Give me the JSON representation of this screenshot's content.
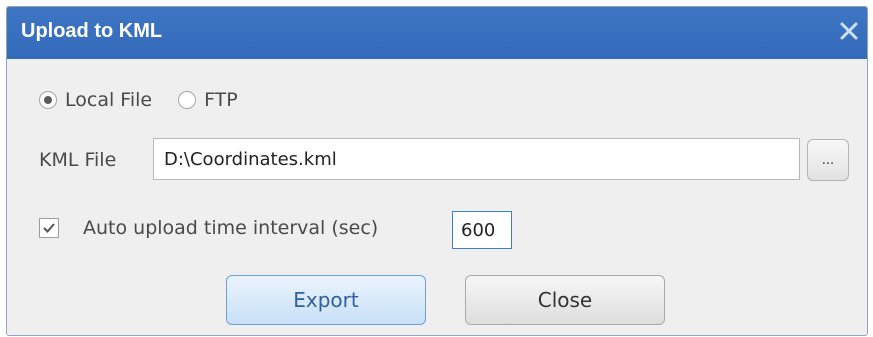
{
  "dialog": {
    "title": "Upload to KML",
    "close_icon": "close-x-icon"
  },
  "source": {
    "options": [
      {
        "label": "Local File",
        "selected": true
      },
      {
        "label": "FTP",
        "selected": false
      }
    ]
  },
  "kml_file": {
    "label": "KML File",
    "value": "D:\\Coordinates.kml",
    "browse_label": "..."
  },
  "auto_upload": {
    "label": "Auto upload time interval (sec)",
    "checked": true,
    "value": "600"
  },
  "buttons": {
    "export_label": "Export",
    "close_label": "Close"
  },
  "colors": {
    "titlebar": "#3a70bf",
    "export_border": "#6aa2de"
  }
}
